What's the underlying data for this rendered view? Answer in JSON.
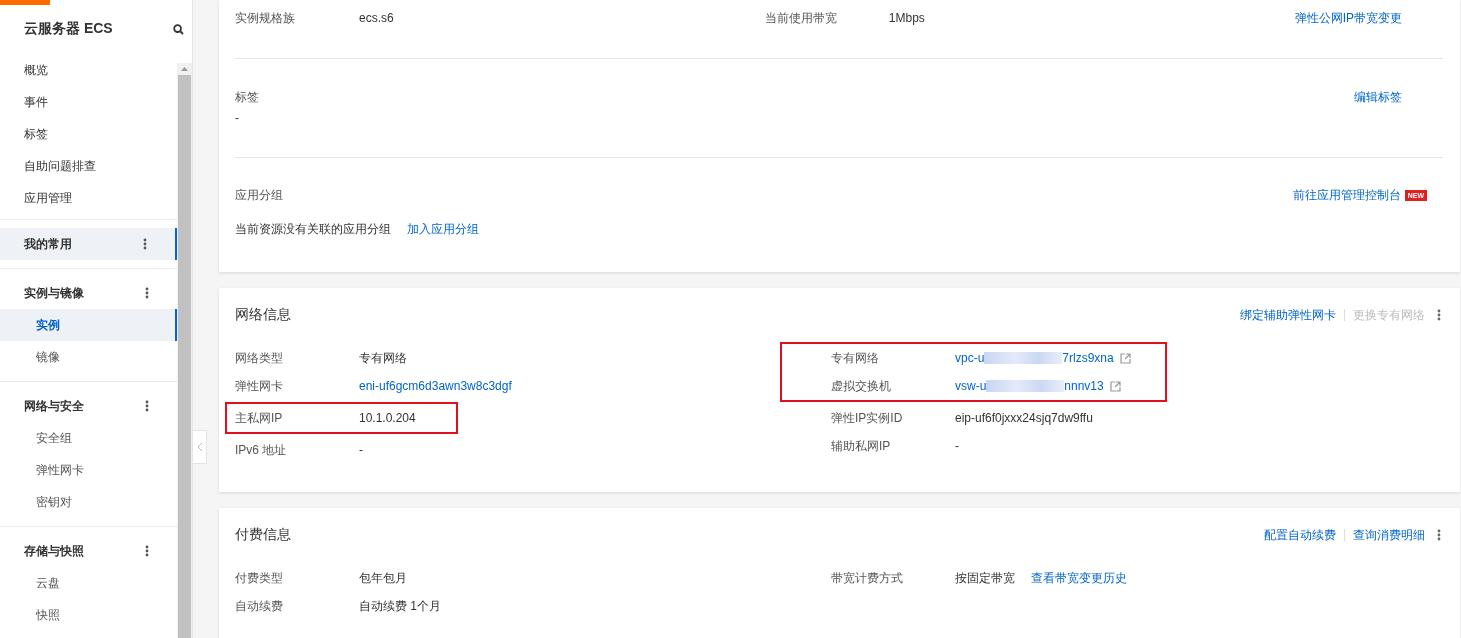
{
  "sidebar": {
    "title": "云服务器 ECS",
    "items": [
      {
        "label": "概览",
        "selected": false
      },
      {
        "label": "事件",
        "selected": false
      },
      {
        "label": "标签",
        "selected": false
      },
      {
        "label": "自助问题排查",
        "selected": false
      },
      {
        "label": "应用管理",
        "selected": false
      }
    ],
    "groups": [
      {
        "title": "我的常用",
        "selected": true
      },
      {
        "title": "实例与镜像",
        "selected": false,
        "children": [
          {
            "label": "实例",
            "selected": true
          },
          {
            "label": "镜像",
            "selected": false
          }
        ]
      },
      {
        "title": "网络与安全",
        "selected": false,
        "children": [
          {
            "label": "安全组",
            "selected": false
          },
          {
            "label": "弹性网卡",
            "selected": false
          },
          {
            "label": "密钥对",
            "selected": false
          }
        ]
      },
      {
        "title": "存储与快照",
        "selected": false,
        "children": [
          {
            "label": "云盘",
            "selected": false
          },
          {
            "label": "快照",
            "selected": false
          }
        ]
      }
    ]
  },
  "basic_card": {
    "sections": [
      {
        "kind": "pairs",
        "pairs": [
          {
            "label": "实例规格族",
            "value": "ecs.s6"
          },
          {
            "label": "当前使用带宽",
            "value": "1Mbps"
          }
        ],
        "action": {
          "label": "弹性公网IP带宽变更"
        }
      },
      {
        "kind": "stacked",
        "label": "标签",
        "value": "-",
        "action": {
          "label": "编辑标签"
        }
      },
      {
        "kind": "group",
        "label": "应用分组",
        "text": "当前资源没有关联的应用分组",
        "link": "加入应用分组",
        "action": {
          "label": "前往应用管理控制台",
          "badge": "NEW"
        }
      }
    ]
  },
  "network_card": {
    "title": "网络信息",
    "actions": [
      {
        "label": "绑定辅助弹性网卡",
        "disabled": false
      },
      {
        "label": "更换专有网络",
        "disabled": true
      }
    ],
    "columns": [
      [
        {
          "highlighted": false,
          "rows": [
            {
              "label": "网络类型",
              "value": "专有网络",
              "kind": "text"
            },
            {
              "label": "弹性网卡",
              "value": "eni-uf6gcm6d3awn3w8c3dgf",
              "kind": "link"
            }
          ]
        },
        {
          "highlighted": true,
          "rows": [
            {
              "label": "主私网IP",
              "value": "10.1.0.204",
              "kind": "text"
            }
          ]
        },
        {
          "highlighted": false,
          "rows": [
            {
              "label": "IPv6 地址",
              "value": "-",
              "kind": "text"
            }
          ]
        }
      ],
      [
        {
          "highlighted": true,
          "rows": [
            {
              "label": "专有网络",
              "value": "vpc-u",
              "value_end": "7rlzs9xna",
              "kind": "redacted-link"
            },
            {
              "label": "虚拟交换机",
              "value": "vsw-u",
              "value_end": "nnnv13",
              "kind": "redacted-link"
            }
          ]
        },
        {
          "highlighted": false,
          "rows": [
            {
              "label": "弹性IP实例ID",
              "value": "eip-uf6f0jxxx24sjq7dw9ffu",
              "kind": "text"
            },
            {
              "label": "辅助私网IP",
              "value": "-",
              "kind": "text"
            }
          ]
        }
      ]
    ]
  },
  "billing_card": {
    "title": "付费信息",
    "actions": [
      {
        "label": "配置自动续费",
        "disabled": false
      },
      {
        "label": "查询消费明细",
        "disabled": false
      }
    ],
    "columns": [
      [
        {
          "highlighted": false,
          "rows": [
            {
              "label": "付费类型",
              "value": "包年包月",
              "kind": "text"
            },
            {
              "label": "自动续费",
              "value": "自动续费 1个月",
              "kind": "text"
            }
          ]
        }
      ],
      [
        {
          "highlighted": false,
          "rows": [
            {
              "label": "带宽计费方式",
              "value": "按固定带宽",
              "link": "查看带宽变更历史",
              "kind": "text-link"
            }
          ]
        }
      ]
    ]
  }
}
